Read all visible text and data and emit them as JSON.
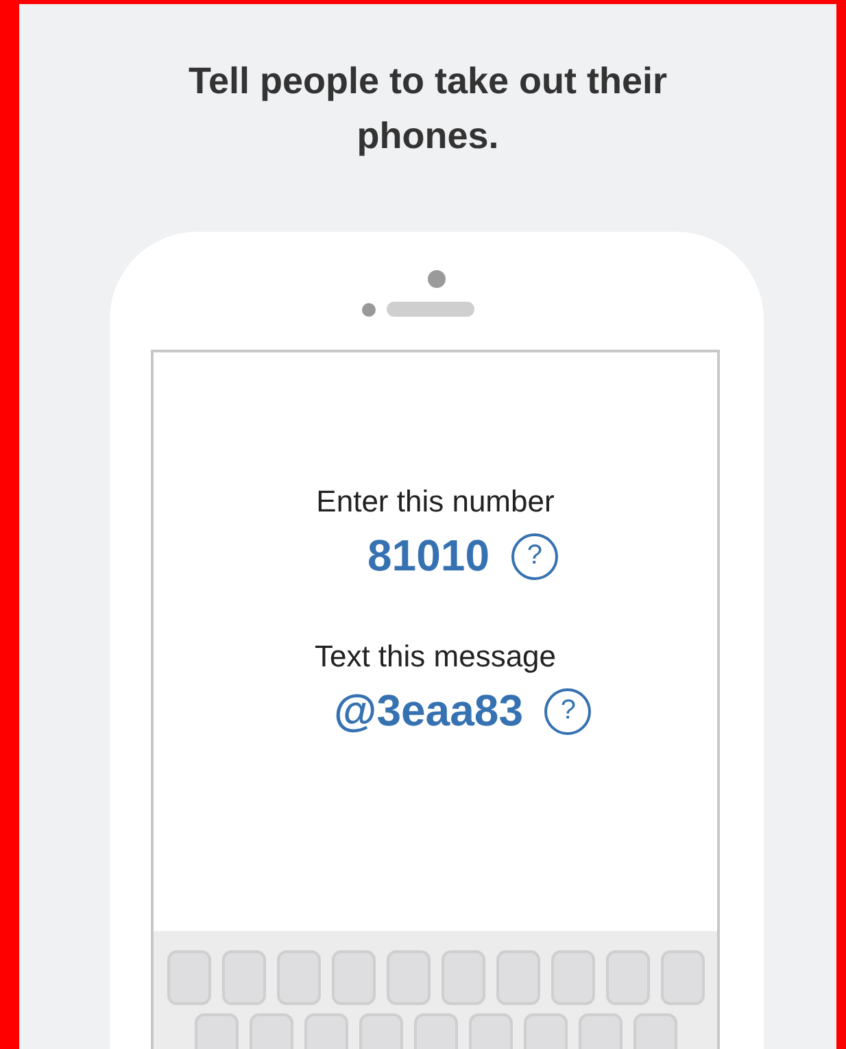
{
  "title": "Tell people to take out their phones.",
  "steps": [
    {
      "label": "Enter this number",
      "value": "81010",
      "help": "?"
    },
    {
      "label": "Text this message",
      "value": "@3eaa83",
      "help": "?"
    }
  ]
}
